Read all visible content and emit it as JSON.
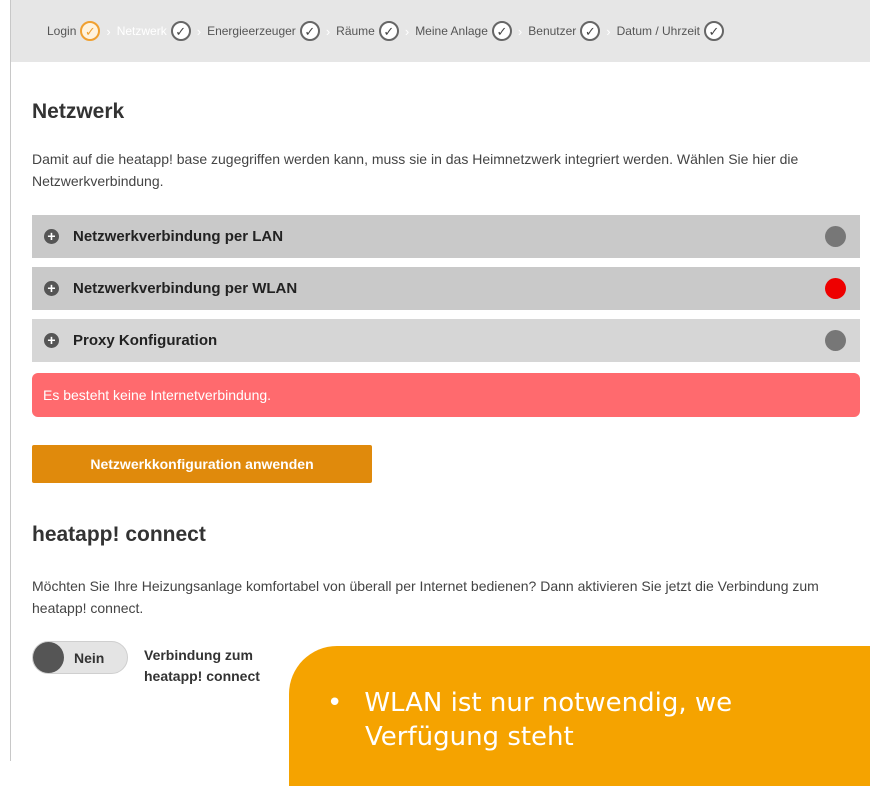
{
  "steps": [
    {
      "label": "Login",
      "state": "current"
    },
    {
      "label": "Netzwerk",
      "state": "active"
    },
    {
      "label": "Energieerzeuger",
      "state": "done"
    },
    {
      "label": "Räume",
      "state": "done"
    },
    {
      "label": "Meine Anlage",
      "state": "done"
    },
    {
      "label": "Benutzer",
      "state": "done"
    },
    {
      "label": "Datum / Uhrzeit",
      "state": "done"
    }
  ],
  "network": {
    "title": "Netzwerk",
    "intro": "Damit auf die heatapp! base zugegriffen werden kann, muss sie in das Heimnetzwerk integriert werden. Wählen Sie hier die Netzwerkverbindung.",
    "sections": [
      {
        "label": "Netzwerkverbindung per LAN",
        "status_color": "#777777"
      },
      {
        "label": "Netzwerkverbindung per WLAN",
        "status_color": "#ee0000"
      },
      {
        "label": "Proxy Konfiguration",
        "status_color": "#777777"
      }
    ],
    "alert": "Es besteht keine Internetverbindung.",
    "apply_button": "Netzwerkkonfiguration anwenden"
  },
  "connect": {
    "title": "heatapp! connect",
    "text": "Möchten Sie Ihre Heizungsanlage komfortabel von überall per Internet bedienen? Dann aktivieren Sie jetzt die Verbindung zum heatapp! connect.",
    "toggle_label": "Nein",
    "toggle_desc": "Verbindung zum heatapp! connect"
  },
  "overlay": {
    "bullet": "•",
    "line1": "WLAN ist nur notwendig, we",
    "line2": "Verfügung steht"
  },
  "colors": {
    "accent": "#e08a0c",
    "alert": "#ff6a6e",
    "overlay": "#f5a300"
  }
}
